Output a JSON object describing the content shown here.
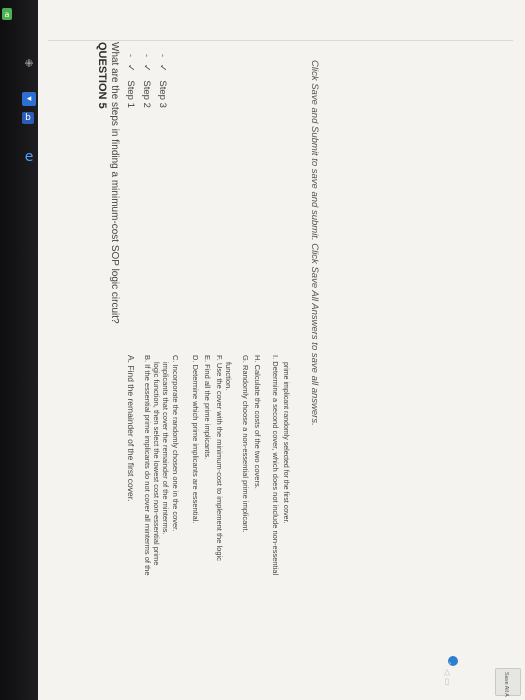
{
  "question": {
    "title": "QUESTION 5",
    "prompt": "What are the steps in finding a minimum-cost SOP logic circuit?"
  },
  "steps": [
    {
      "marker": "-",
      "check": "✓",
      "label": "Step 1"
    },
    {
      "marker": "-",
      "check": "✓",
      "label": "Step 2"
    },
    {
      "marker": "-",
      "check": "✓",
      "label": "Step 3"
    }
  ],
  "options": {
    "A": "A. Find the remainder of the first cover.",
    "B1": "B. If the essential prime implicants do not cover all minterms of the",
    "B2": "logic function, then select the lowest cost non-essential prime",
    "B3": "implicants that cover the remainder of the minterms.",
    "C": "C. Incorporate the randomly chosen one in the cover.",
    "D": "D. Determine which prime implicants are essential.",
    "E": "E. Find all the prime implicants.",
    "F1": "F. Use the cover with the minimum-cost to implement the logic",
    "F2": "function.",
    "G": "G. Randomly choose a non-essential prime implicant.",
    "H": "H. Calculate the costs of the two covers.",
    "I1": "I. Determine a second cover, which does not include non-essential",
    "I2": "prime implicant randomly selected for the first cover."
  },
  "footer": {
    "hint": "Click Save and Submit to save and submit. Click Save All Answers to save all answers.",
    "save_all_label": "Save All A"
  },
  "taskbar": {
    "icons": [
      "a",
      "grid-icon",
      "store-icon",
      "word-icon",
      "edge-icon"
    ],
    "tray": "⌃ ◁ ▭"
  }
}
